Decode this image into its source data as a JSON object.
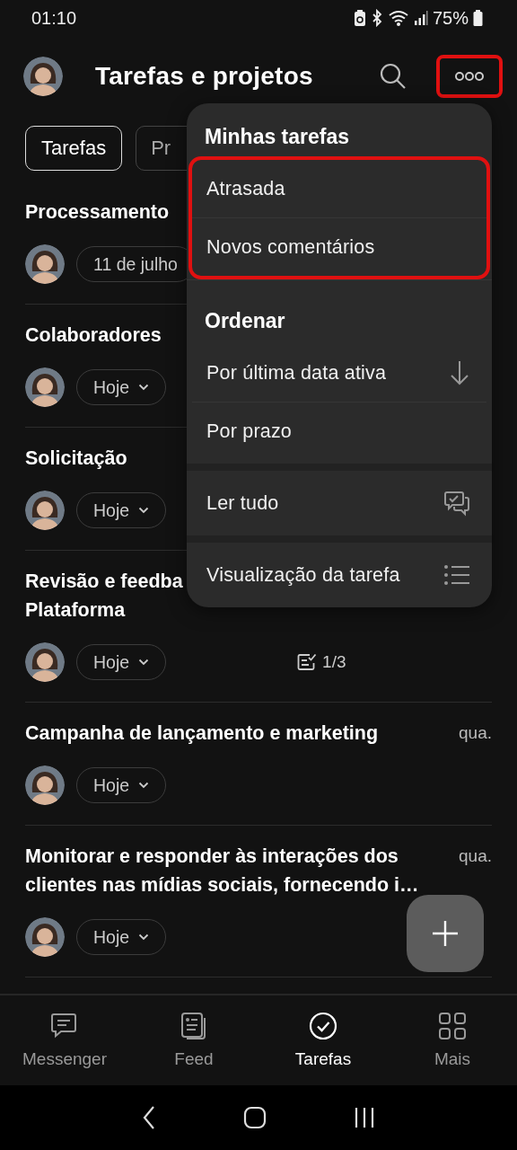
{
  "status_bar": {
    "time": "01:10",
    "battery": "75%"
  },
  "header": {
    "title": "Tarefas e projetos",
    "more_highlighted": true
  },
  "tabs": [
    {
      "label": "Tarefas",
      "selected": true
    },
    {
      "label": "Pr",
      "selected": false
    }
  ],
  "tasks": [
    {
      "title": "Processamento",
      "due": "11 de julho",
      "dropdown": false
    },
    {
      "title": "Colaboradores",
      "due": "Hoje",
      "dropdown": true
    },
    {
      "title": "Solicitação",
      "due": "Hoje",
      "dropdown": true
    },
    {
      "title": "Revisão e feedba\nPlataforma",
      "due": "Hoje",
      "dropdown": true,
      "checklist": "1/3"
    },
    {
      "title": "Campanha de lançamento e marketing",
      "date": "qua.",
      "due": "Hoje",
      "dropdown": true
    },
    {
      "title": "Monitorar e responder às interações dos\nclientes nas mídias sociais, fornecendo i…",
      "date": "qua.",
      "due": "Hoje",
      "dropdown": true
    }
  ],
  "menu": {
    "sections": [
      {
        "heading": "Minhas tarefas",
        "highlighted": true,
        "items": [
          {
            "label": "Atrasada",
            "kind": "plain"
          },
          {
            "label": "Novos comentários",
            "kind": "plain"
          }
        ]
      },
      {
        "heading": "Ordenar",
        "highlighted": false,
        "items": [
          {
            "label": "Por última data ativa",
            "kind": "sort"
          },
          {
            "label": "Por prazo",
            "kind": "plain"
          }
        ]
      },
      {
        "highlighted": false,
        "items": [
          {
            "label": "Ler tudo",
            "kind": "read"
          }
        ]
      },
      {
        "highlighted": false,
        "items": [
          {
            "label": "Visualização da tarefa",
            "kind": "view"
          }
        ]
      }
    ]
  },
  "bottom_nav": [
    {
      "label": "Messenger",
      "kind": "chat",
      "selected": false
    },
    {
      "label": "Feed",
      "kind": "feed",
      "selected": false
    },
    {
      "label": "Tarefas",
      "kind": "tasks",
      "selected": true
    },
    {
      "label": "Mais",
      "kind": "more",
      "selected": false
    }
  ]
}
